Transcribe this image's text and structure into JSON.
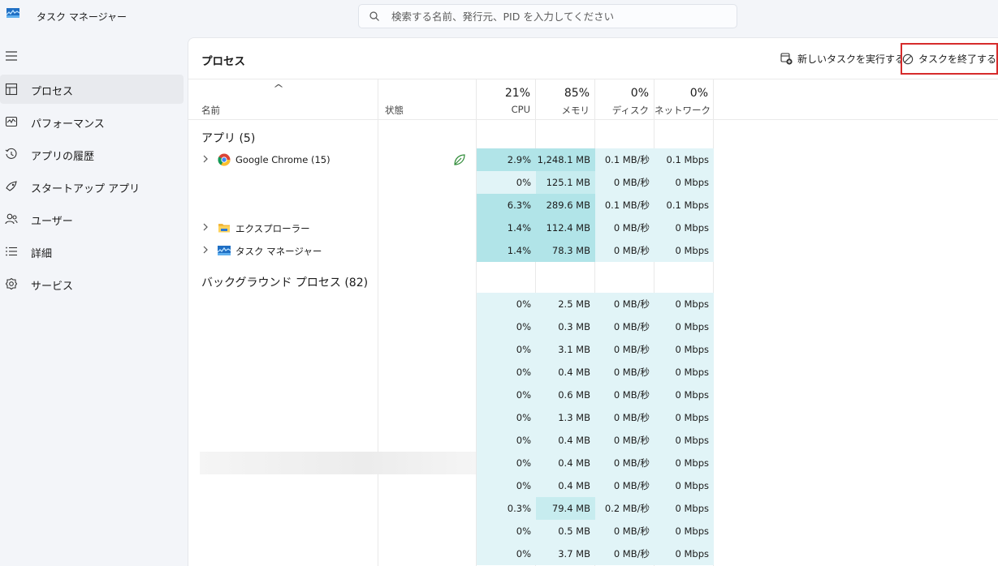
{
  "app": {
    "title": "タスク マネージャー"
  },
  "search": {
    "placeholder": "検索する名前、発行元、PID を入力してください"
  },
  "sidebar": {
    "items": [
      {
        "label": "プロセス",
        "icon": "processes-icon",
        "active": true
      },
      {
        "label": "パフォーマンス",
        "icon": "performance-icon"
      },
      {
        "label": "アプリの履歴",
        "icon": "app-history-icon"
      },
      {
        "label": "スタートアップ アプリ",
        "icon": "startup-icon"
      },
      {
        "label": "ユーザー",
        "icon": "users-icon"
      },
      {
        "label": "詳細",
        "icon": "details-icon"
      },
      {
        "label": "サービス",
        "icon": "services-icon"
      }
    ]
  },
  "main": {
    "title": "プロセス",
    "run_task_label": "新しいタスクを実行する",
    "end_task_label": "タスクを終了する"
  },
  "columns": {
    "name": "名前",
    "status": "状態",
    "cpu": {
      "pct": "21%",
      "label": "CPU"
    },
    "memory": {
      "pct": "85%",
      "label": "メモリ"
    },
    "disk": {
      "pct": "0%",
      "label": "ディスク"
    },
    "network": {
      "pct": "0%",
      "label": "ネットワーク"
    }
  },
  "groups": {
    "apps": "アプリ (5)",
    "background": "バックグラウンド プロセス (82)"
  },
  "app_rows": [
    {
      "name": "Google Chrome (15)",
      "icon": "chrome-icon",
      "expandable": true,
      "status_icon": "efficiency-leaf-icon",
      "cpu": "2.9%",
      "mem": "1,248.1 MB",
      "disk": "0.1 MB/秒",
      "net": "0.1 Mbps",
      "heat": [
        "h3",
        "h3",
        "h1",
        "h1"
      ]
    },
    {
      "name": "",
      "cpu": "0%",
      "mem": "125.1 MB",
      "disk": "0 MB/秒",
      "net": "0 Mbps",
      "heat": [
        "h1",
        "h2",
        "h1",
        "h1"
      ]
    },
    {
      "name": "",
      "cpu": "6.3%",
      "mem": "289.6 MB",
      "disk": "0.1 MB/秒",
      "net": "0.1 Mbps",
      "heat": [
        "h3",
        "h3",
        "h1",
        "h1"
      ]
    },
    {
      "name": "エクスプローラー",
      "icon": "folder-icon",
      "expandable": true,
      "cpu": "1.4%",
      "mem": "112.4 MB",
      "disk": "0 MB/秒",
      "net": "0 Mbps",
      "heat": [
        "h3",
        "h3",
        "h1",
        "h1"
      ]
    },
    {
      "name": "タスク マネージャー",
      "icon": "task-manager-icon",
      "expandable": true,
      "cpu": "1.4%",
      "mem": "78.3 MB",
      "disk": "0 MB/秒",
      "net": "0 Mbps",
      "heat": [
        "h3",
        "h3",
        "h1",
        "h1"
      ]
    }
  ],
  "bg_rows": [
    {
      "cpu": "0%",
      "mem": "2.5 MB",
      "disk": "0 MB/秒",
      "net": "0 Mbps"
    },
    {
      "cpu": "0%",
      "mem": "0.3 MB",
      "disk": "0 MB/秒",
      "net": "0 Mbps"
    },
    {
      "cpu": "0%",
      "mem": "3.1 MB",
      "disk": "0 MB/秒",
      "net": "0 Mbps"
    },
    {
      "cpu": "0%",
      "mem": "0.4 MB",
      "disk": "0 MB/秒",
      "net": "0 Mbps"
    },
    {
      "cpu": "0%",
      "mem": "0.6 MB",
      "disk": "0 MB/秒",
      "net": "0 Mbps"
    },
    {
      "cpu": "0%",
      "mem": "1.3 MB",
      "disk": "0 MB/秒",
      "net": "0 Mbps"
    },
    {
      "cpu": "0%",
      "mem": "0.4 MB",
      "disk": "0 MB/秒",
      "net": "0 Mbps"
    },
    {
      "cpu": "0%",
      "mem": "0.4 MB",
      "disk": "0 MB/秒",
      "net": "0 Mbps",
      "hover": true
    },
    {
      "cpu": "0%",
      "mem": "0.4 MB",
      "disk": "0 MB/秒",
      "net": "0 Mbps"
    },
    {
      "cpu": "0.3%",
      "mem": "79.4 MB",
      "disk": "0.2 MB/秒",
      "net": "0 Mbps",
      "mem_heat": "h2"
    },
    {
      "cpu": "0%",
      "mem": "0.5 MB",
      "disk": "0 MB/秒",
      "net": "0 Mbps"
    },
    {
      "cpu": "0%",
      "mem": "3.7 MB",
      "disk": "0 MB/秒",
      "net": "0 Mbps"
    }
  ]
}
